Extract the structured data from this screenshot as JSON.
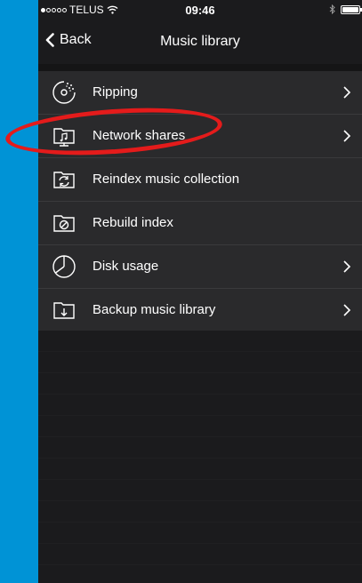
{
  "statusbar": {
    "carrier": "TELUS",
    "time": "09:46"
  },
  "navbar": {
    "back_label": "Back",
    "title": "Music library"
  },
  "menu": {
    "items": [
      {
        "label": "Ripping",
        "icon": "disc-rip-icon",
        "has_chevron": true
      },
      {
        "label": "Network shares",
        "icon": "network-folder-icon",
        "has_chevron": true
      },
      {
        "label": "Reindex music collection",
        "icon": "refresh-folder-icon",
        "has_chevron": false
      },
      {
        "label": "Rebuild index",
        "icon": "blocked-folder-icon",
        "has_chevron": false
      },
      {
        "label": "Disk usage",
        "icon": "pie-chart-icon",
        "has_chevron": true
      },
      {
        "label": "Backup music library",
        "icon": "download-folder-icon",
        "has_chevron": true
      }
    ]
  },
  "colors": {
    "background": "#0093d6",
    "screen": "#1b1b1d",
    "row": "#2a2a2c",
    "highlight": "#e41b1b"
  }
}
